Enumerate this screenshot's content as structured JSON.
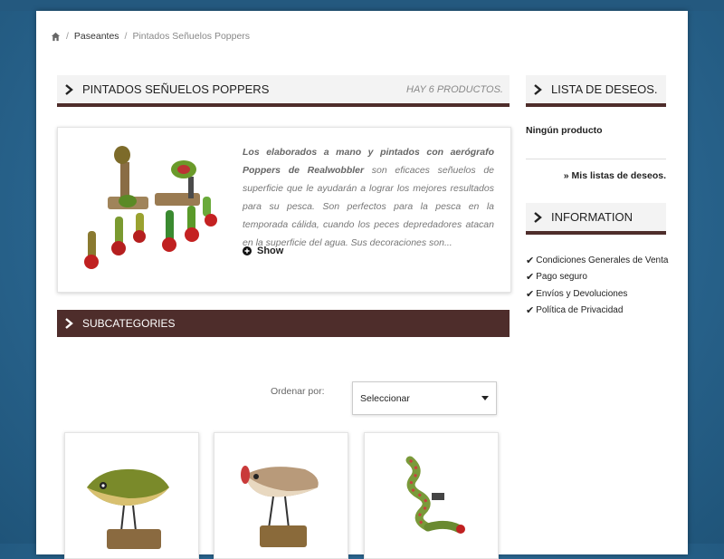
{
  "breadcrumb": {
    "home_icon": "home-icon",
    "items": [
      "Paseantes",
      "Pintados Señuelos Poppers"
    ]
  },
  "category": {
    "title": "PINTADOS SEÑUELOS POPPERS",
    "count": "HAY 6 PRODUCTOS.",
    "description_bold": "Los elaborados a mano y pintados con aerógrafo Poppers de Realwobbler",
    "description_rest": " son eficaces señuelos de superficie que le ayudarán a lograr los mejores resultados para su pesca. Son perfectos para la pesca en la temporada cálida, cuando los peces depredadores atacan en la superficie del agua. Sus decoraciones son...",
    "show_label": "Show"
  },
  "subcategories": {
    "title": "SUBCATEGORIES"
  },
  "sort": {
    "label": "Ordenar por:",
    "selected": "Seleccionar"
  },
  "sidebar": {
    "wishlist": {
      "title": "LISTA DE DESEOS.",
      "empty": "Ningún producto",
      "link": "» Mis listas de deseos."
    },
    "information": {
      "title": "INFORMATION",
      "items": [
        "Condiciones Generales de Venta",
        "Pago seguro",
        "Envíos y Devoluciones",
        "Política de Privacidad"
      ]
    }
  },
  "colors": {
    "brand_brown": "#4e2d2b",
    "header_bg": "#f3f3f3",
    "background_blue": "#2a6690"
  }
}
